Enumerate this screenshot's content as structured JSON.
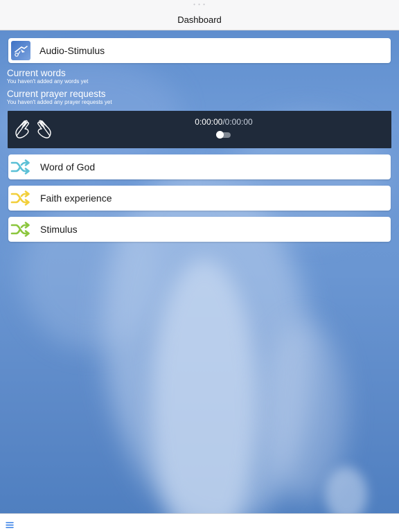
{
  "statusbar": {
    "dots": "• • •"
  },
  "navbar": {
    "title": "Dashboard"
  },
  "audio": {
    "label": "Audio-Stimulus",
    "icon": "audio-thumbnail-icon"
  },
  "words": {
    "heading": "Current words",
    "empty_text": "You haven't added any words yet"
  },
  "prayers": {
    "heading": "Current prayer requests",
    "empty_text": "You haven't added any prayer requests yet"
  },
  "player": {
    "elapsed": "0:00:00",
    "separator": "/",
    "total": "0:00:00",
    "icon": "praying-hands-icon",
    "toggle_on": false
  },
  "categories": [
    {
      "label": "Word of God",
      "icon": "shuffle-icon",
      "color": "#5bc0d6"
    },
    {
      "label": "Faith experience",
      "icon": "shuffle-icon",
      "color": "#f2cf3b"
    },
    {
      "label": "Stimulus",
      "icon": "shuffle-icon",
      "color": "#8cc63e"
    }
  ],
  "bottombar": {
    "icon": "menu-icon",
    "color": "#2f7ae5"
  }
}
